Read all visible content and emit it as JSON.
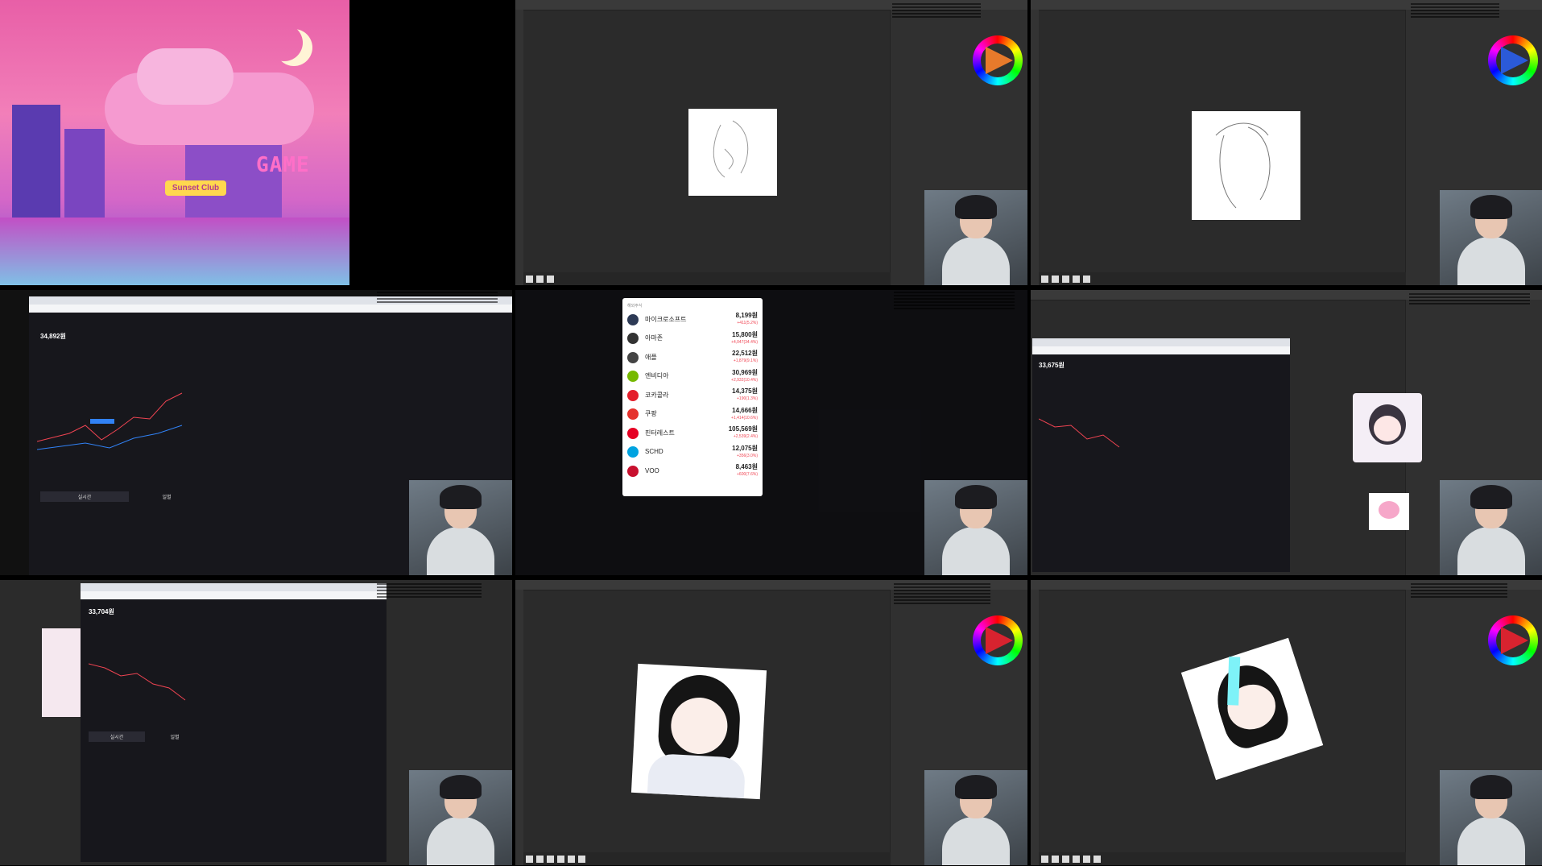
{
  "tile1": {
    "sign_game": "GAME",
    "sign_club": "Sunset Club"
  },
  "tile5": {
    "popup_title": "해외주식",
    "stocks": [
      {
        "name": "마이크로소프트",
        "value": "8,199원",
        "change": "+411(5.2%)",
        "logo_color": "#2d3a55",
        "icon": "win-logo"
      },
      {
        "name": "아마존",
        "value": "15,800원",
        "change": "+4,047(34.4%)",
        "logo_color": "#333",
        "icon": "amazon-logo"
      },
      {
        "name": "애플",
        "value": "22,512원",
        "change": "+1,879(9.1%)",
        "logo_color": "#444",
        "icon": "apple-logo"
      },
      {
        "name": "엔비디아",
        "value": "30,969원",
        "change": "+2,932(10.4%)",
        "logo_color": "#76b900",
        "icon": "nvidia-logo"
      },
      {
        "name": "코카콜라",
        "value": "14,375원",
        "change": "+190(1.3%)",
        "logo_color": "#e41e2b",
        "icon": "coca-cola-logo"
      },
      {
        "name": "쿠팡",
        "value": "14,666원",
        "change": "+1,414(10.6%)",
        "logo_color": "#e5322d",
        "icon": "coupang-logo"
      },
      {
        "name": "핀터레스트",
        "value": "105,569원",
        "change": "+2,539(2.4%)",
        "logo_color": "#e60023",
        "icon": "pinterest-logo"
      },
      {
        "name": "SCHD",
        "value": "12,075원",
        "change": "+356(3.0%)",
        "logo_color": "#00a3e0",
        "icon": "schd-logo"
      },
      {
        "name": "VOO",
        "value": "8,463원",
        "change": "+600(7.6%)",
        "logo_color": "#c8102e",
        "icon": "voo-logo"
      }
    ]
  },
  "tile4": {
    "price": "34,892원",
    "tabs": [
      "실시간",
      "일별"
    ]
  },
  "tile6": {
    "price": "33,675원"
  },
  "tile7": {
    "price": "33,704원",
    "tabs": [
      "실시간",
      "일별"
    ]
  },
  "colors": {
    "toss_blue": "#3182f6",
    "toss_red": "#f04452",
    "ps_bg": "#2b2b2b"
  }
}
